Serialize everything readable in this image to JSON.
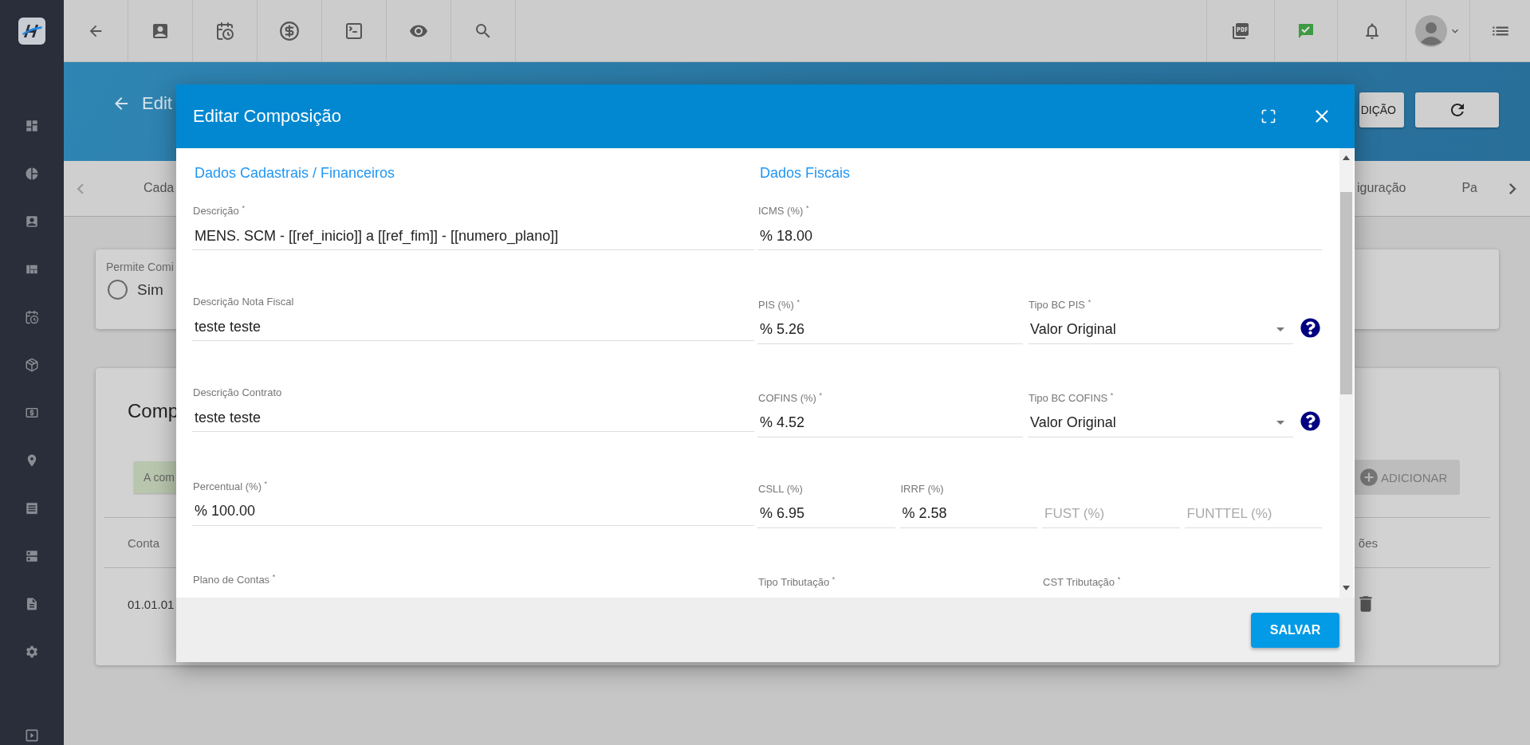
{
  "page": {
    "title": "Edit",
    "header_buttons": [
      {
        "label": "DIÇÃO"
      }
    ],
    "tabs": [
      {
        "label": "Cada",
        "selected": false
      },
      {
        "label": "iguração",
        "selected": false
      },
      {
        "label": "Pa",
        "selected": false
      }
    ]
  },
  "permission_card": {
    "label": "Permite Comi",
    "options": [
      {
        "label": "Sim",
        "selected": false
      }
    ]
  },
  "composition_card": {
    "title": "Comp",
    "alert": "A com",
    "add_button": "ADICIONAR",
    "columns": [
      "Conta",
      "ões"
    ],
    "rows": [
      {
        "cells": [
          "01.01.01"
        ]
      }
    ]
  },
  "dialog": {
    "title": "Editar Composição",
    "save_button": "SALVAR",
    "sections": [
      {
        "title": "Dados Cadastrais / Financeiros",
        "rows": [
          {
            "fields": [
              {
                "kind": "text",
                "label": "Descrição $^{*}$",
                "value": "MENS. SCM - [[ref_inicio]] a [[ref_fim]] - [[numero_plano]]"
              }
            ]
          },
          {
            "fields": [
              {
                "kind": "text",
                "label": "Descrição Nota Fiscal",
                "value": "teste teste"
              }
            ]
          },
          {
            "fields": [
              {
                "kind": "text",
                "label": "Descrição Contrato",
                "value": "teste teste"
              }
            ]
          },
          {
            "fields": [
              {
                "kind": "text",
                "label": "Percentual (%) $^{*}$",
                "value": "% 100.00"
              }
            ]
          },
          {
            "fields": [
              {
                "kind": "text",
                "label": "Plano de Contas $^{*}$"
              }
            ]
          }
        ]
      },
      {
        "title": "Dados Fiscais",
        "rows": [
          {
            "fields": [
              {
                "kind": "text",
                "label": "ICMS (%) $^{*}$",
                "value": "% 18.00"
              }
            ]
          },
          {
            "fields": [
              {
                "kind": "text",
                "label": "PIS (%) $^{*}$",
                "value": "% 5.26"
              },
              {
                "kind": "select",
                "label": "Tipo BC PIS $^{*}$",
                "value": "Valor Original",
                "help": true
              }
            ]
          },
          {
            "fields": [
              {
                "kind": "text",
                "label": "COFINS (%) $^{*}$",
                "value": "% 4.52"
              },
              {
                "kind": "select",
                "label": "Tipo BC COFINS $^{*}$",
                "value": "Valor Original",
                "help": true
              }
            ]
          },
          {
            "fields": [
              {
                "kind": "text",
                "label": "CSLL (%)",
                "value": "% 6.95"
              },
              {
                "kind": "text",
                "label": "IRRF (%)",
                "value": "% 2.58"
              },
              {
                "kind": "text",
                "placeholder": "FUST (%)"
              },
              {
                "kind": "text",
                "placeholder": "FUNTTEL (%)"
              }
            ]
          },
          {
            "fields": [
              {
                "kind": "text",
                "label": "Tipo Tributação $^{*}$"
              },
              {
                "kind": "text",
                "label": "CST Tributação $^{*}$"
              }
            ]
          }
        ]
      }
    ]
  }
}
